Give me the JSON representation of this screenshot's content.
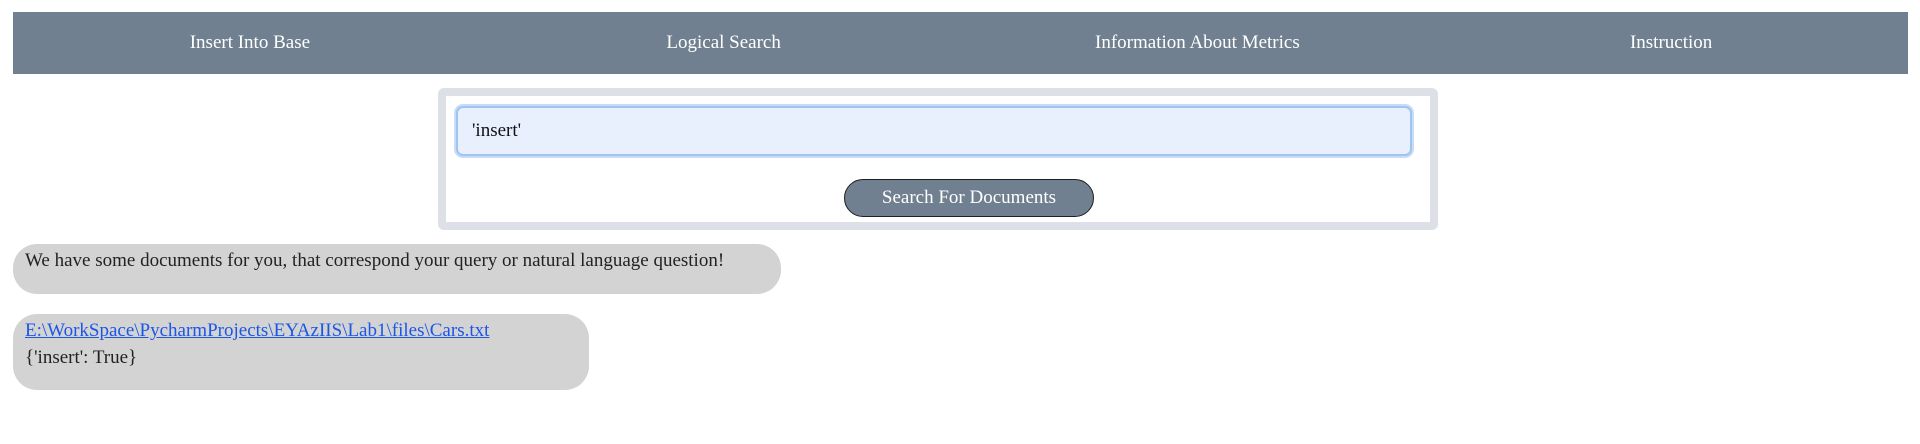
{
  "nav": {
    "items": [
      {
        "label": "Insert Into Base"
      },
      {
        "label": "Logical Search"
      },
      {
        "label": "Information About Metrics"
      },
      {
        "label": "Instruction"
      }
    ]
  },
  "search": {
    "query_value": "'insert'",
    "button_label": "Search For Documents"
  },
  "results": {
    "message": "We have some documents for you, that correspond your query or natural language question!",
    "items": [
      {
        "path": "E:\\WorkSpace\\PycharmProjects\\EYAzIIS\\Lab1\\files\\Cars.txt",
        "meta": "{'insert': True}"
      }
    ]
  },
  "colors": {
    "nav_background": "#708090",
    "bubble_background": "#d3d3d3",
    "link": "#1a56e8",
    "input_background": "#e8f0fe"
  }
}
